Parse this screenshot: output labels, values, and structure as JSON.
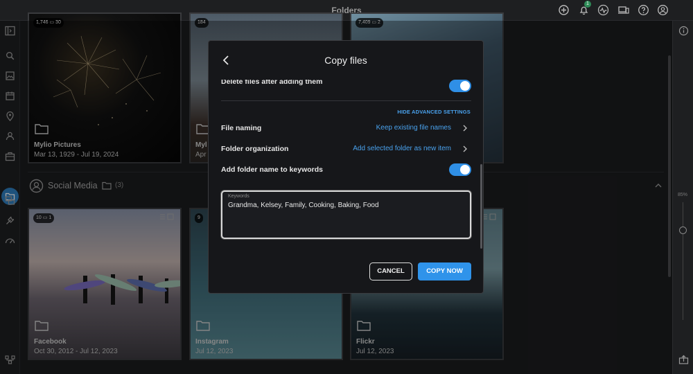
{
  "topbar": {
    "title": "Folders",
    "notification_count": "1",
    "icons": [
      "add-icon",
      "bell-icon",
      "activity-icon",
      "devices-icon",
      "help-icon",
      "account-icon"
    ]
  },
  "left_rail": {
    "icons": [
      "sidebar-toggle-icon",
      "search-icon",
      "photos-icon",
      "calendar-icon",
      "map-pin-icon",
      "people-icon",
      "albums-icon",
      "folders-icon",
      "sources-icon",
      "tools-icon",
      "dashboard-icon",
      "network-icon"
    ],
    "active": "folders-icon"
  },
  "right_rail": {
    "zoom_label": "85%",
    "zoom_level": 0.2,
    "icons": [
      "info-icon",
      "export-icon"
    ]
  },
  "top_tiles": [
    {
      "name": "Mylio Pictures",
      "date": "Mar 13, 1929 - Jul 19, 2024",
      "photos": "1,746",
      "folders": "30"
    },
    {
      "name": "Myl",
      "date": "Apr",
      "photos": "184",
      "folders": ""
    },
    {
      "name": "",
      "date": "",
      "photos": "7,409",
      "folders": "2"
    }
  ],
  "section": {
    "title": "Social Media",
    "count": "(3)"
  },
  "social_tiles": [
    {
      "name": "Facebook",
      "date": "Oct 30, 2012 - Jul 12, 2023",
      "photos": "10",
      "folders": "1"
    },
    {
      "name": "Instagram",
      "date": "Jul 12, 2023",
      "photos": "9",
      "folders": ""
    },
    {
      "name": "Flickr",
      "date": "Jul 12, 2023",
      "photos": "",
      "folders": ""
    }
  ],
  "modal": {
    "title": "Copy files",
    "delete_files_label": "Delete files after adding them",
    "advanced_link": "HIDE ADVANCED SETTINGS",
    "file_naming_label": "File naming",
    "file_naming_value": "Keep existing file names",
    "folder_org_label": "Folder organization",
    "folder_org_value": "Add selected folder as new item",
    "add_folder_name_label": "Add folder name to keywords",
    "keywords_label": "Keywords",
    "keywords_value": "Grandma, Kelsey, Family, Cooking, Baking, Food",
    "cancel_label": "CANCEL",
    "copy_label": "COPY NOW",
    "accent_color": "#2f93ea"
  }
}
